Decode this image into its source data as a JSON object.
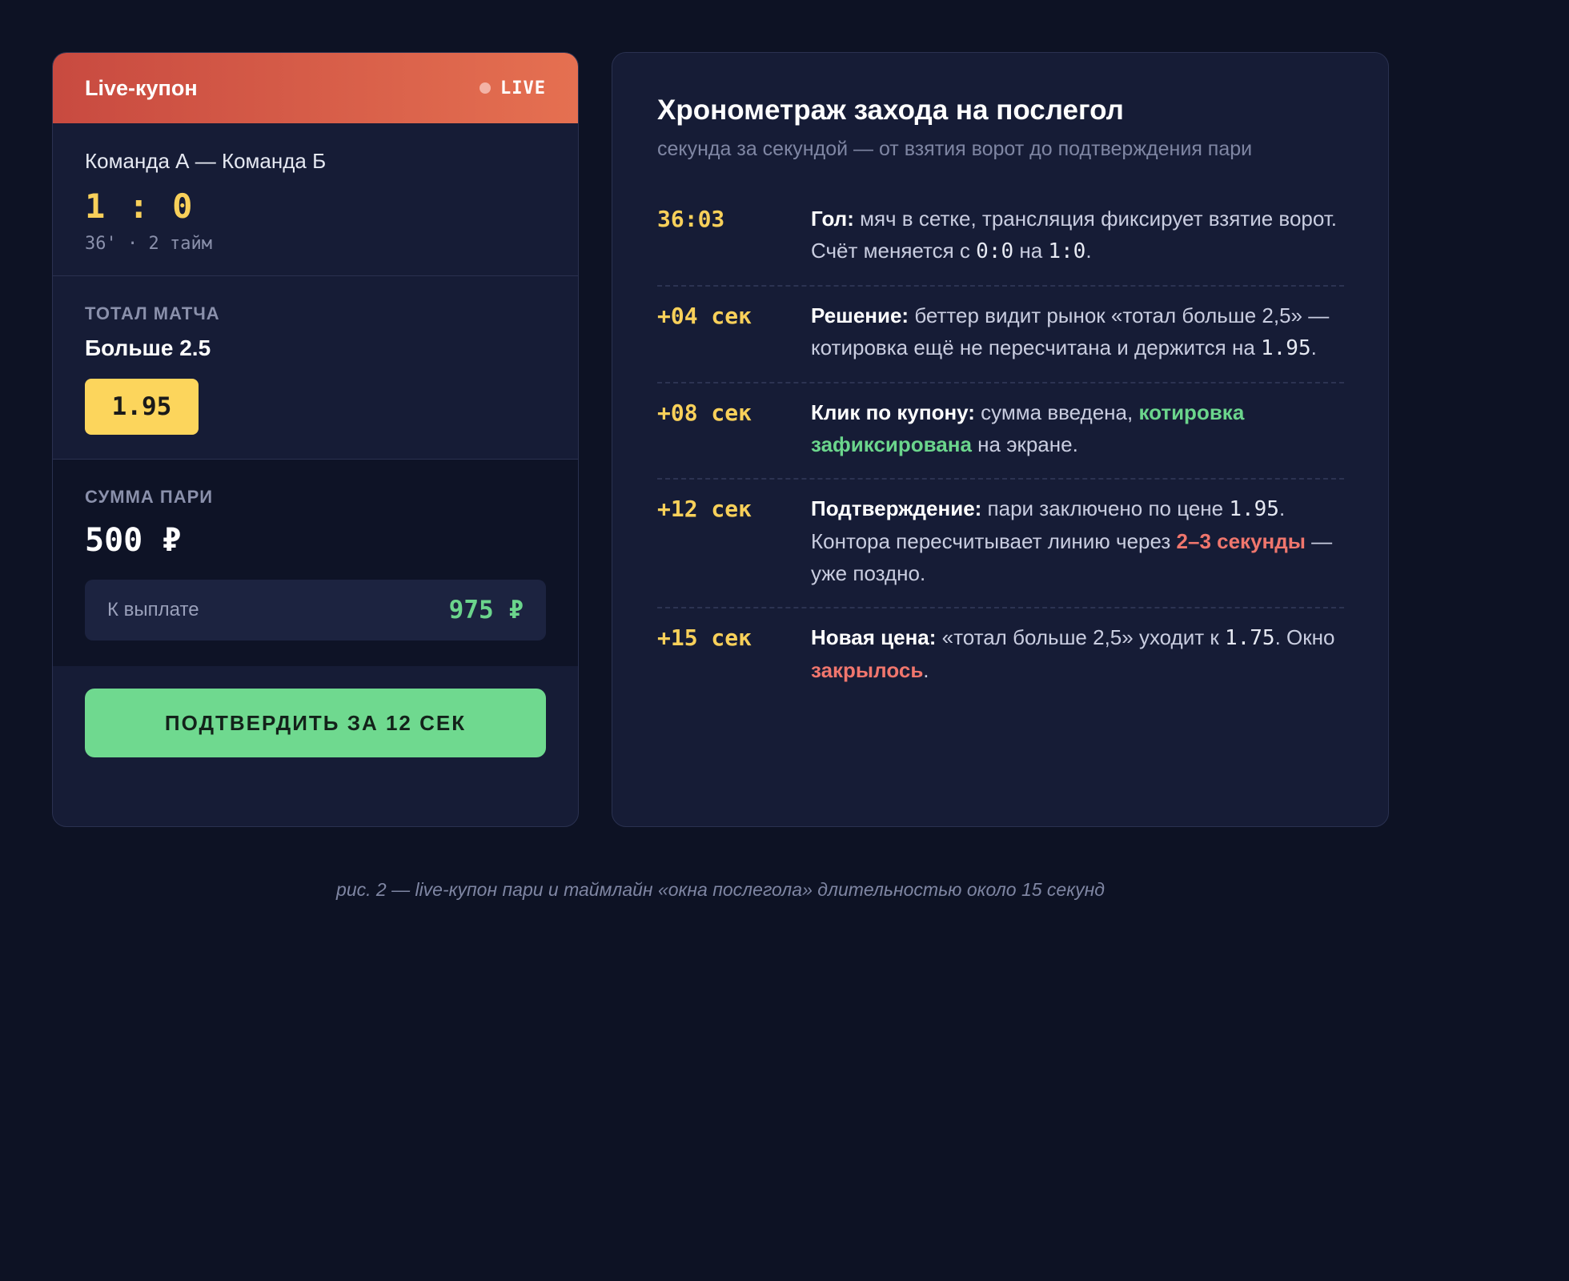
{
  "coupon": {
    "title": "Live-купон",
    "live_label": "LIVE",
    "teams": "Команда А — Команда Б",
    "score": "1 : 0",
    "match_time": "36' · 2 тайм",
    "market_label": "ТОТАЛ МАТЧА",
    "market_name": "Больше 2.5",
    "odd": "1.95",
    "stake_label": "СУММА ПАРИ",
    "stake_value": "500 ₽",
    "payout_label": "К выплате",
    "payout_value": "975 ₽",
    "confirm_label": "ПОДТВЕРДИТЬ ЗА 12 СЕК"
  },
  "timeline": {
    "title": "Хронометраж захода на послегол",
    "subtitle": "секунда за секундой — от взятия ворот до подтверждения пари",
    "events": [
      {
        "time": "36:03",
        "head": "Гол:",
        "t1": " мяч в сетке, трансляция фиксирует взятие ворот. Счёт меняется с ",
        "n1": "0:0",
        "t2": " на ",
        "n2": "1:0",
        "t3": "."
      },
      {
        "time": "+04 сек",
        "head": "Решение:",
        "t1": " беттер видит рынок «тотал больше 2,5» — котировка ещё не пересчитана и держится на ",
        "n1": "1.95",
        "t2": "."
      },
      {
        "time": "+08 сек",
        "head": "Клик по купону:",
        "t1": " сумма введена, ",
        "good": "котировка зафиксирована",
        "t2": " на экране."
      },
      {
        "time": "+12 сек",
        "head": "Подтверждение:",
        "t1": " пари заключено по цене ",
        "n1": "1.95",
        "t2": ". Контора пересчитывает линию через ",
        "bad": "2–3 секунды",
        "t3": " — уже поздно."
      },
      {
        "time": "+15 сек",
        "head": "Новая цена:",
        "t1": " «тотал больше 2,5» уходит к ",
        "n1": "1.75",
        "t2": ". Окно ",
        "bad": "закрылось",
        "t3": "."
      }
    ]
  },
  "caption": "рис. 2 — live-купон пари и таймлайн «окна послегола» длительностью около 15 секунд",
  "colors": {
    "background": "#0d1224",
    "accent_yellow": "#f8d05a",
    "accent_green": "#6bd58c",
    "accent_red": "#f0766d",
    "header_gradient_start": "#c84a40",
    "header_gradient_end": "#e57051"
  }
}
